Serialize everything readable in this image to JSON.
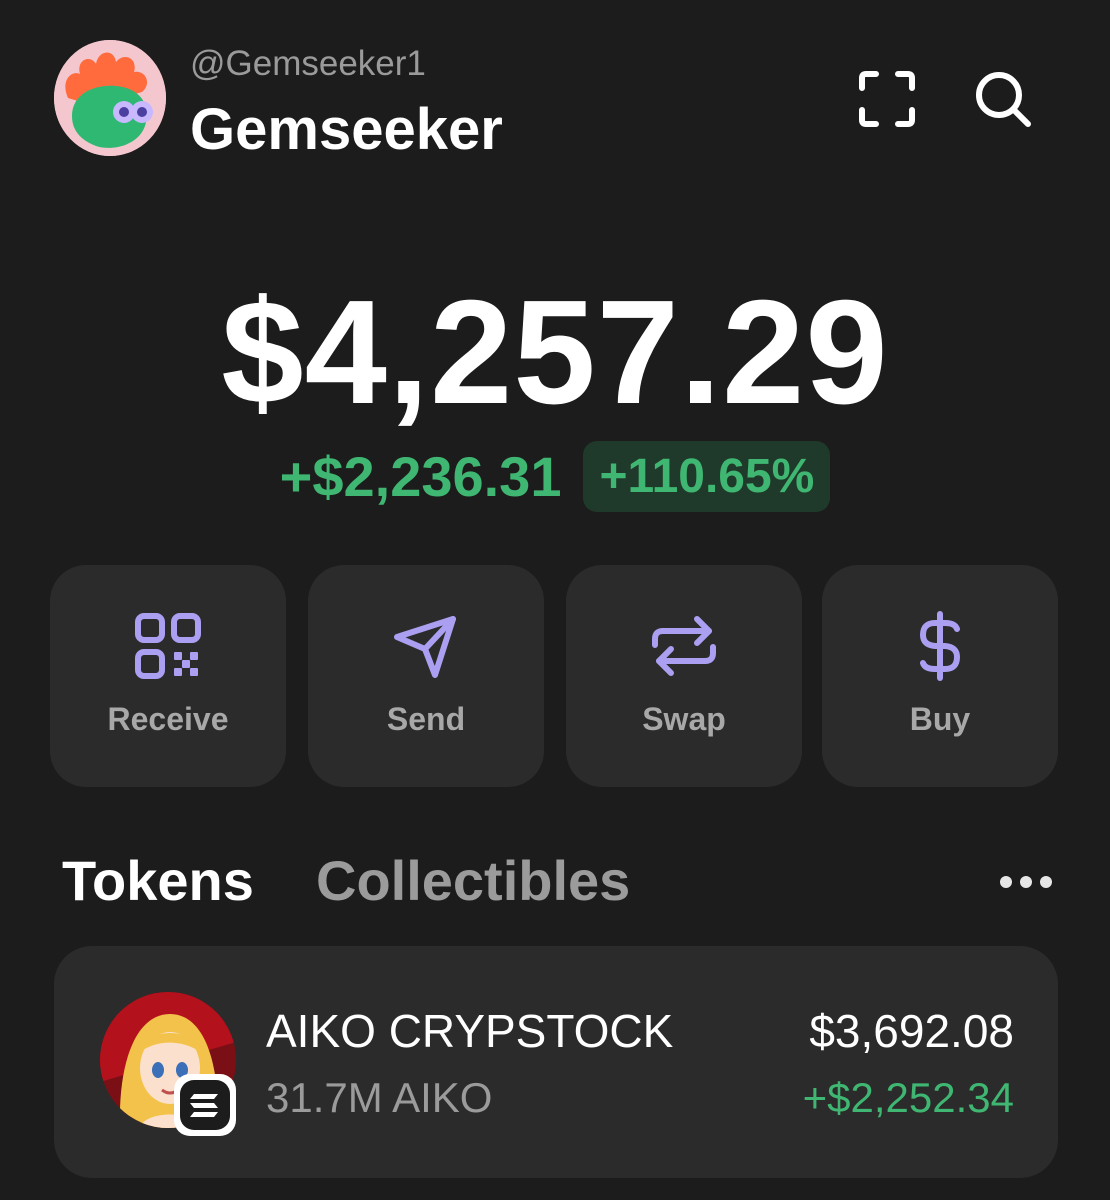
{
  "header": {
    "username": "@Gemseeker1",
    "display_name": "Gemseeker",
    "avatar_icon": "rooster-avatar",
    "scan_icon": "scan-icon",
    "search_icon": "search-icon"
  },
  "portfolio": {
    "balance": "$4,257.29",
    "change_amount": "+$2,236.31",
    "change_percent": "+110.65%"
  },
  "actions": [
    {
      "label": "Receive",
      "icon": "qr-code-icon"
    },
    {
      "label": "Send",
      "icon": "send-icon"
    },
    {
      "label": "Swap",
      "icon": "swap-icon"
    },
    {
      "label": "Buy",
      "icon": "dollar-icon"
    }
  ],
  "tabs": [
    {
      "label": "Tokens",
      "active": true
    },
    {
      "label": "Collectibles",
      "active": false
    }
  ],
  "more_icon": "more-dots-icon",
  "tokens": [
    {
      "name": "AIKO CRYPSTOCK",
      "amount": "31.7M AIKO",
      "value": "$3,692.08",
      "change": "+$2,252.34",
      "chain_icon": "solana-icon"
    }
  ],
  "colors": {
    "background": "#1c1c1c",
    "card": "#2b2b2b",
    "accent": "#ab9ff2",
    "positive": "#3fb671",
    "muted": "#9b9b9b"
  }
}
